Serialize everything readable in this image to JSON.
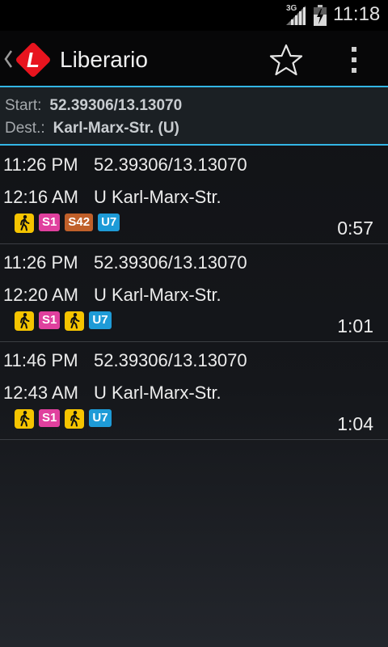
{
  "status_bar": {
    "time": "11:18",
    "network": "3G"
  },
  "action_bar": {
    "title": "Liberario",
    "logo_letter": "L"
  },
  "header": {
    "start_label": "Start:",
    "start_value": "52.39306/13.13070",
    "dest_label": "Dest.:",
    "dest_value": "Karl-Marx-Str. (U)"
  },
  "colors": {
    "accent": "#33b5e5",
    "walk": "#f5c400",
    "S1": "#e0409e",
    "S42": "#c0602a",
    "U7": "#1e9bd7",
    "logo": "#e8141e"
  },
  "trips": [
    {
      "dep_time": "11:26 PM",
      "from": "52.39306/13.13070",
      "arr_time": "12:16 AM",
      "to": "U Karl-Marx-Str.",
      "duration": "0:57",
      "legs": [
        {
          "type": "walk",
          "icon": "walk-icon"
        },
        {
          "type": "line",
          "label": "S1",
          "color": "#e0409e"
        },
        {
          "type": "line",
          "label": "S42",
          "color": "#c0602a"
        },
        {
          "type": "line",
          "label": "U7",
          "color": "#1e9bd7"
        }
      ]
    },
    {
      "dep_time": "11:26 PM",
      "from": "52.39306/13.13070",
      "arr_time": "12:20 AM",
      "to": "U Karl-Marx-Str.",
      "duration": "1:01",
      "legs": [
        {
          "type": "walk",
          "icon": "walk-icon"
        },
        {
          "type": "line",
          "label": "S1",
          "color": "#e0409e"
        },
        {
          "type": "walk",
          "icon": "walk-icon"
        },
        {
          "type": "line",
          "label": "U7",
          "color": "#1e9bd7"
        }
      ]
    },
    {
      "dep_time": "11:46 PM",
      "from": "52.39306/13.13070",
      "arr_time": "12:43 AM",
      "to": "U Karl-Marx-Str.",
      "duration": "1:04",
      "legs": [
        {
          "type": "walk",
          "icon": "walk-icon"
        },
        {
          "type": "line",
          "label": "S1",
          "color": "#e0409e"
        },
        {
          "type": "walk",
          "icon": "walk-icon"
        },
        {
          "type": "line",
          "label": "U7",
          "color": "#1e9bd7"
        }
      ]
    }
  ]
}
